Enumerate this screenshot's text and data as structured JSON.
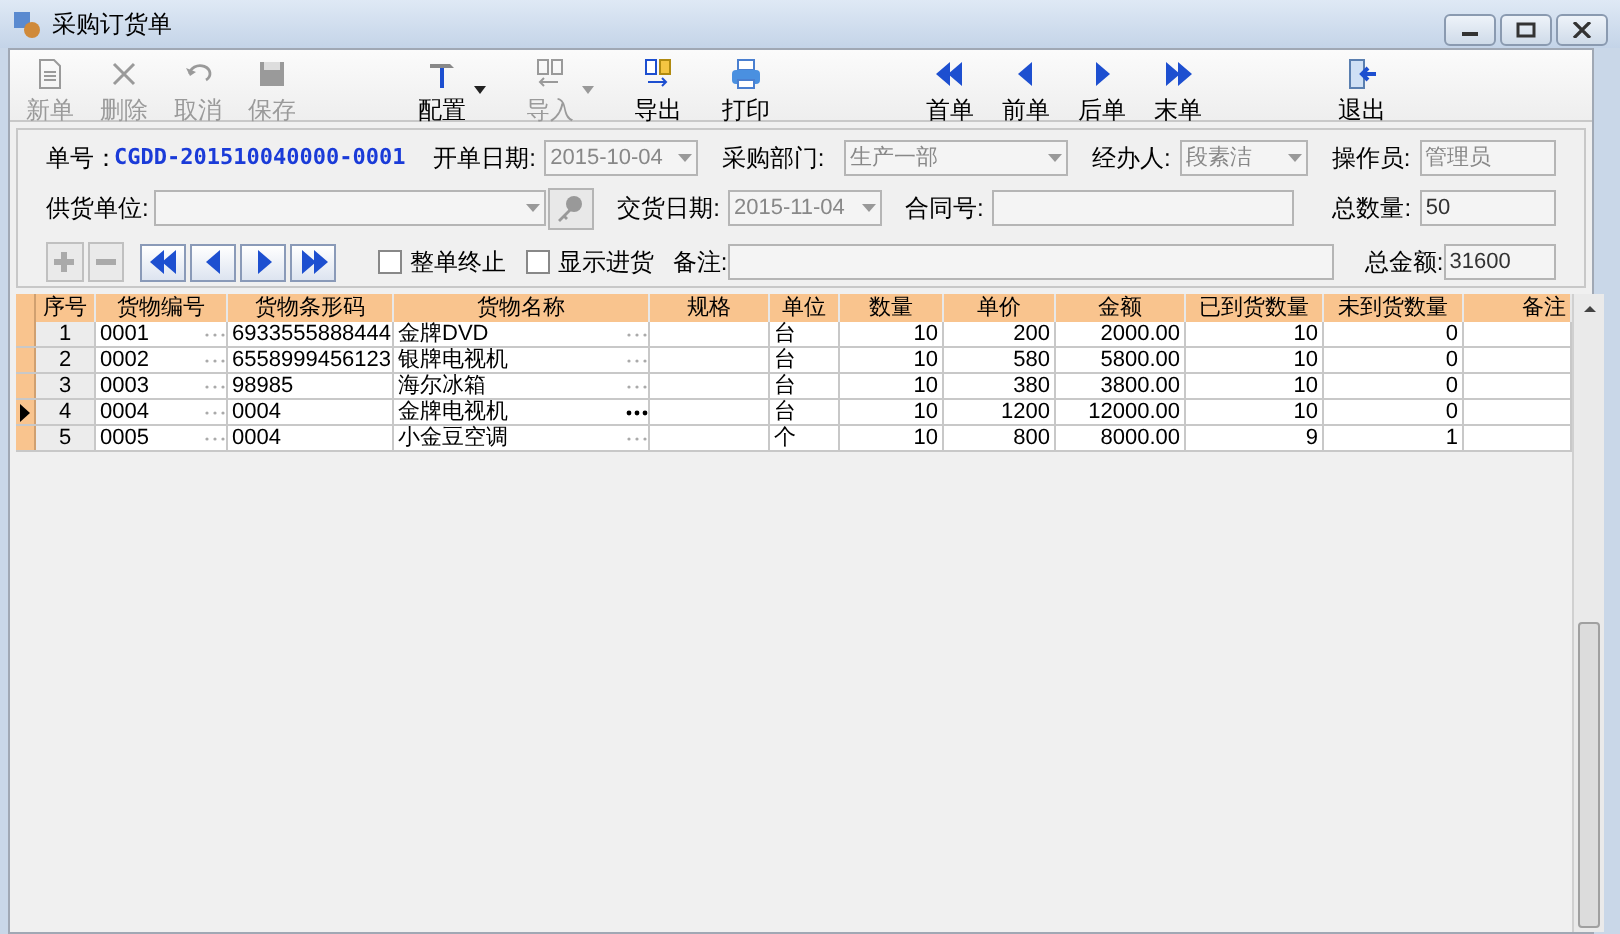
{
  "window": {
    "title": "采购订货单"
  },
  "toolbar": [
    {
      "label": "新单",
      "disabled": true,
      "dropdown": false
    },
    {
      "label": "删除",
      "disabled": true,
      "dropdown": false
    },
    {
      "label": "取消",
      "disabled": true,
      "dropdown": false
    },
    {
      "label": "保存",
      "disabled": true,
      "dropdown": false
    },
    {
      "label": "配置",
      "disabled": false,
      "dropdown": true
    },
    {
      "label": "导入",
      "disabled": true,
      "dropdown": true
    },
    {
      "label": "导出",
      "disabled": false,
      "dropdown": false
    },
    {
      "label": "打印",
      "disabled": false,
      "dropdown": false
    },
    {
      "label": "首单",
      "disabled": false,
      "dropdown": false
    },
    {
      "label": "前单",
      "disabled": false,
      "dropdown": false
    },
    {
      "label": "后单",
      "disabled": false,
      "dropdown": false
    },
    {
      "label": "末单",
      "disabled": false,
      "dropdown": false
    },
    {
      "label": "退出",
      "disabled": false,
      "dropdown": false
    }
  ],
  "form": {
    "order_no_label": "单号：",
    "order_no": "CGDD-201510040000-0001",
    "open_date_label": "开单日期:",
    "open_date": "2015-10-04",
    "dept_label": "采购部门:",
    "dept": "生产一部",
    "handler_label": "经办人:",
    "handler": "段素洁",
    "operator_label": "操作员:",
    "operator": "管理员",
    "supplier_label": "供货单位:",
    "delivery_date_label": "交货日期:",
    "delivery_date": "2015-11-04",
    "contract_label": "合同号:",
    "total_qty_label": "总数量:",
    "total_qty": "50",
    "remark_label": "备注:",
    "total_amount_label": "总金额:",
    "total_amount": "31600",
    "checkboxes": [
      {
        "label": "整单终止",
        "checked": false
      },
      {
        "label": "显示进货",
        "checked": false
      }
    ]
  },
  "table": {
    "columns": [
      "序号",
      "货物编号",
      "货物条形码",
      "货物名称",
      "规格",
      "单位",
      "数量",
      "单价",
      "金额",
      "已到货数量",
      "未到货数量",
      "备注"
    ],
    "rows": [
      {
        "selected": false,
        "cells": [
          "1",
          "0001",
          "6933555888444",
          "金牌DVD",
          "",
          "台",
          "10",
          "200",
          "2000.00",
          "10",
          "0",
          ""
        ]
      },
      {
        "selected": false,
        "cells": [
          "2",
          "0002",
          "6558999456123",
          "银牌电视机",
          "",
          "台",
          "10",
          "580",
          "5800.00",
          "10",
          "0",
          ""
        ]
      },
      {
        "selected": false,
        "cells": [
          "3",
          "0003",
          "98985",
          "海尔冰箱",
          "",
          "台",
          "10",
          "380",
          "3800.00",
          "10",
          "0",
          ""
        ]
      },
      {
        "selected": true,
        "cells": [
          "4",
          "0004",
          "0004",
          "金牌电视机",
          "",
          "台",
          "10",
          "1200",
          "12000.00",
          "10",
          "0",
          ""
        ]
      },
      {
        "selected": false,
        "cells": [
          "5",
          "0005",
          "0004",
          "小金豆空调",
          "",
          "个",
          "10",
          "800",
          "8000.00",
          "9",
          "1",
          ""
        ]
      }
    ]
  }
}
